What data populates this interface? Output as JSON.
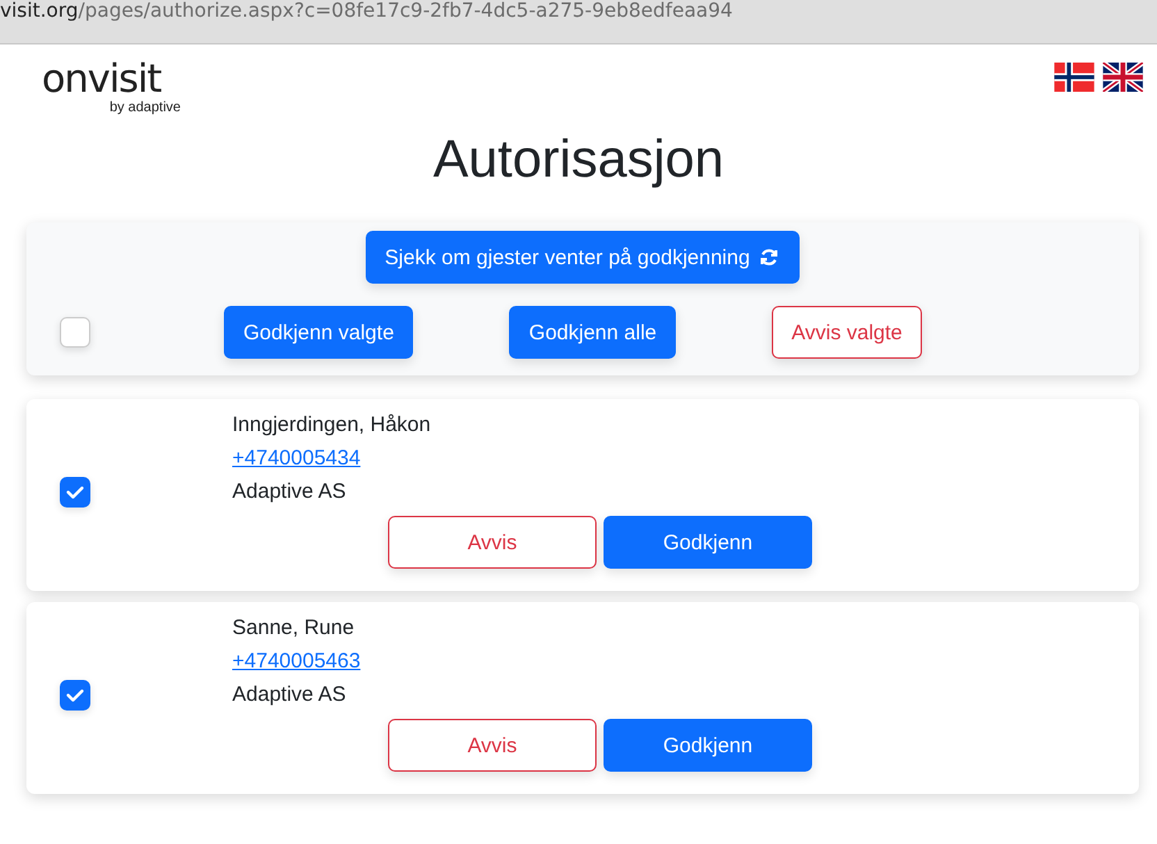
{
  "address_bar": {
    "host": "visit.org",
    "path": "/pages/authorize.aspx?c=08fe17c9-2fb7-4dc5-a275-9eb8edfeaa94"
  },
  "logo": {
    "name": "onvisit",
    "tagline": "by adaptive"
  },
  "languages": [
    {
      "kind": "no"
    },
    {
      "kind": "gb"
    }
  ],
  "title": "Autorisasjon",
  "toolbar": {
    "refresh_button": "Sjekk om gjester venter på godkjenning",
    "select_all_checked": false,
    "approve_selected": "Godkjenn valgte",
    "approve_all": "Godkjenn alle",
    "reject_selected": "Avvis valgte"
  },
  "guests": [
    {
      "name": "Inngjerdingen, Håkon",
      "phone": "+4740005434",
      "company": "Adaptive AS",
      "checked": true,
      "reject": "Avvis",
      "approve": "Godkjenn"
    },
    {
      "name": "Sanne, Rune",
      "phone": "+4740005463",
      "company": "Adaptive AS",
      "checked": true,
      "reject": "Avvis",
      "approve": "Godkjenn"
    }
  ]
}
